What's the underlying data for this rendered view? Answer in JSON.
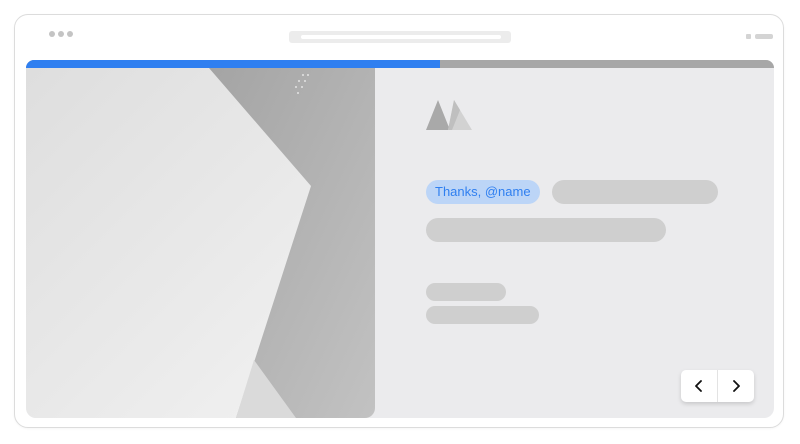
{
  "progress": {
    "fraction": 0.553
  },
  "message": {
    "mention_text": "Thanks, @name"
  },
  "colors": {
    "accent": "#2f7ff0",
    "mention_bg": "#bcd5f7",
    "placeholder": "#cfcfcf",
    "panel_bg": "#ebebed",
    "track": "#a7a7a7"
  },
  "icons": {
    "logo": "mountain-logo-icon",
    "prev": "chevron-left-icon",
    "next": "chevron-right-icon",
    "window_controls": "window-dots-icon"
  }
}
